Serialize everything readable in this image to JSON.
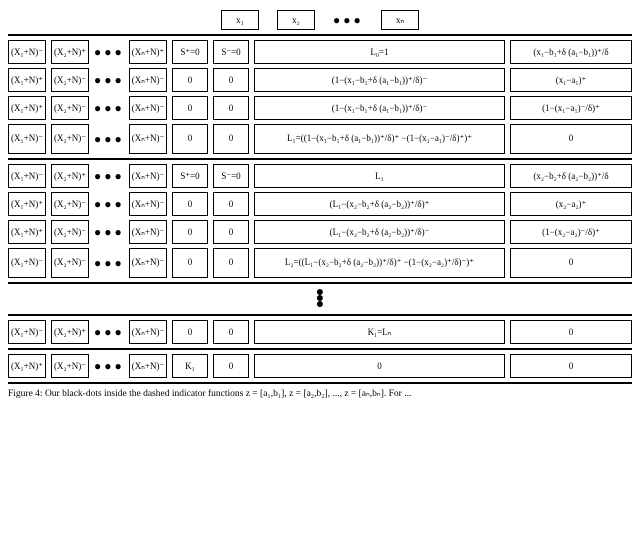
{
  "header": {
    "xs": [
      "x₁",
      "x₂",
      "xₙ"
    ],
    "dots": "● ● ●"
  },
  "dots": "● ● ●",
  "vdots": "⋮",
  "block1": {
    "row0": {
      "xs": [
        "(X₁+N)⁻",
        "(X₂+N)⁺",
        "(Xₙ+N)⁺"
      ],
      "s1": "S⁺=0",
      "s2": "S⁻=0",
      "l": "L₀=1",
      "r": "(x₁−b₁+δ (a₁−b₁))⁺/δ"
    },
    "row1": {
      "xs": [
        "(X₁+N)⁺",
        "(X₂+N)⁻",
        "(Xₙ+N)⁻"
      ],
      "s1": "0",
      "s2": "0",
      "l": "(1−(x₁−b₁+δ (a₁−b₁))⁺/δ)⁻",
      "r": "(x₁−a₁)⁺"
    },
    "row2": {
      "xs": [
        "(X₁+N)⁺",
        "(X₂+N)⁻",
        "(Xₙ+N)⁻"
      ],
      "s1": "0",
      "s2": "0",
      "l": "(1−(x₁−b₁+δ (a₁−b₁))⁺/δ)⁻",
      "r": "(1−(x₁−a₁)⁻/δ)⁺"
    },
    "row3": {
      "xs": [
        "(X₁+N)⁻",
        "(X₂+N)⁻",
        "(Xₙ+N)⁻"
      ],
      "s1": "0",
      "s2": "0",
      "l": "L₁=((1−(x₁−b₁+δ (a₁−b₁))⁺/δ)⁺\n−(1−(x₁−a₁)⁻/δ)⁺)⁺",
      "r": "0"
    }
  },
  "block2": {
    "row0": {
      "xs": [
        "(X₁+N)⁻",
        "(X₂+N)⁺",
        "(Xₙ+N)⁻"
      ],
      "s1": "S⁺=0",
      "s2": "S⁻=0",
      "l": "L₁",
      "r": "(x₂−b₂+δ (a₂−b₂))⁺/δ"
    },
    "row1": {
      "xs": [
        "(X₁+N)⁺",
        "(X₂+N)⁻",
        "(Xₙ+N)⁻"
      ],
      "s1": "0",
      "s2": "0",
      "l": "(L₁−(x₂−b₂+δ (a₂−b₂))⁺/δ)⁺",
      "r": "(x₂−a₂)⁺"
    },
    "row2": {
      "xs": [
        "(X₁+N)⁺",
        "(X₂+N)⁻",
        "(Xₙ+N)⁻"
      ],
      "s1": "0",
      "s2": "0",
      "l": "(L₁−(x₂−b₂+δ (a₂−b₂))⁺/δ)⁻",
      "r": "(1−(x₂−a₂)⁻/δ)⁺"
    },
    "row3": {
      "xs": [
        "(X₁+N)⁻",
        "(X₂+N)⁻",
        "(Xₙ+N)⁻"
      ],
      "s1": "0",
      "s2": "0",
      "l": "L₂=((L₁−(x₂−b₂+δ (a₂−b₂))⁺/δ)⁺\n−(1−(x₂−a₂)⁺/δ)⁻)⁺",
      "r": "0"
    }
  },
  "block3": {
    "row0": {
      "xs": [
        "(X₁+N)⁻",
        "(X₂+N)⁺",
        "(Xₙ+N)⁻"
      ],
      "s1": "0",
      "s2": "0",
      "l": "K₁=Lₙ",
      "r": "0"
    }
  },
  "block4": {
    "row0": {
      "xs": [
        "(X₁+N)⁺",
        "(X₂+N)⁻",
        "(Xₙ+N)⁻"
      ],
      "s1": "K₁",
      "s2": "0",
      "l": "0",
      "r": "0"
    }
  },
  "caption": "Figure 4: Our black-dots inside the dashed indicator functions z = [a₁,b₁], z = [a₂,b₂], ..., z = [aₙ,bₙ]. For ..."
}
